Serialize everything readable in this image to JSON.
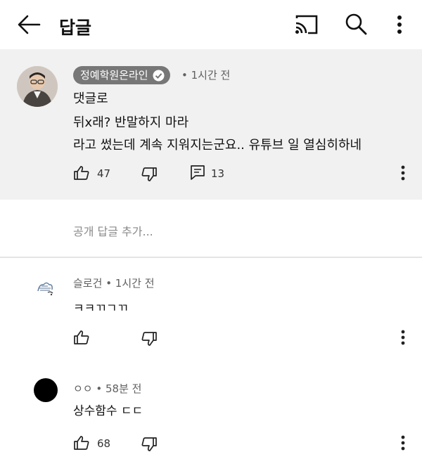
{
  "header": {
    "title": "답글",
    "icons": [
      "back-arrow-icon",
      "cast-icon",
      "search-icon",
      "more-vert-icon"
    ]
  },
  "parent_comment": {
    "author": "정예학원온라인",
    "verified": true,
    "time": "• 1시간 전",
    "lines": [
      "댓글로",
      "뒤x래? 반말하지 마라",
      "라고 썼는데 계속 지워지는군요.. 유튜브 일 열심히하네"
    ],
    "likes": "47",
    "replies": "13"
  },
  "add_reply": {
    "placeholder": "공개 답글 추가..."
  },
  "replies": [
    {
      "author": "슬로건",
      "time": "• 1시간 전",
      "text": "ㅋㅋㄲㄱㄲ",
      "likes": ""
    },
    {
      "author": "ㅇㅇ",
      "time": "• 58분 전",
      "text": "상수함수 ㄷㄷ",
      "likes": "68"
    }
  ],
  "colors": {
    "parent_bg": "#f1f1f1",
    "chip_bg": "#777777",
    "meta_text": "#606060"
  }
}
